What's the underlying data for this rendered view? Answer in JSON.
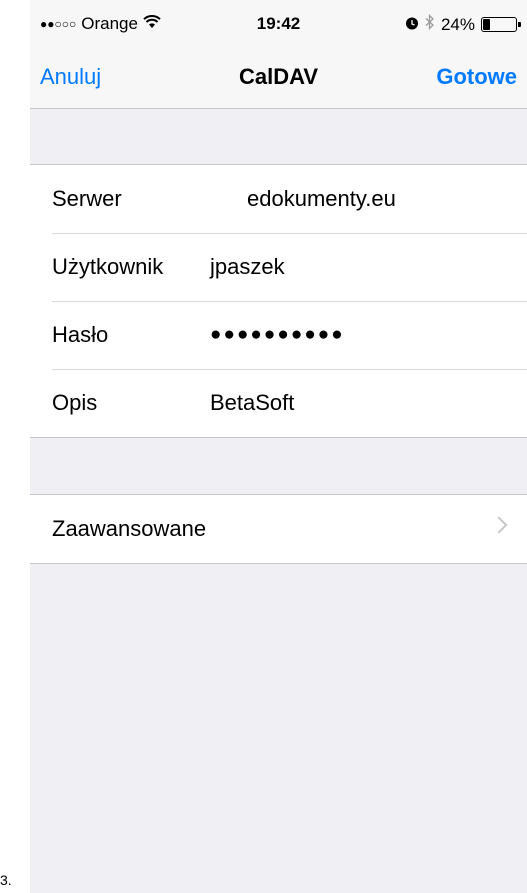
{
  "status_bar": {
    "signal_dots": "●●○○○",
    "carrier": "Orange",
    "time": "19:42",
    "battery_percent": "24%",
    "battery_level": 0.24
  },
  "nav": {
    "cancel": "Anuluj",
    "title": "CalDAV",
    "done": "Gotowe"
  },
  "account_fields": [
    {
      "label": "Serwer",
      "value": "edokumenty.eu"
    },
    {
      "label": "Użytkownik",
      "value": "jpaszek"
    },
    {
      "label": "Hasło",
      "value": "●●●●●●●●●●"
    },
    {
      "label": "Opis",
      "value": "BetaSoft"
    }
  ],
  "advanced": {
    "label": "Zaawansowane"
  },
  "caption": "3."
}
